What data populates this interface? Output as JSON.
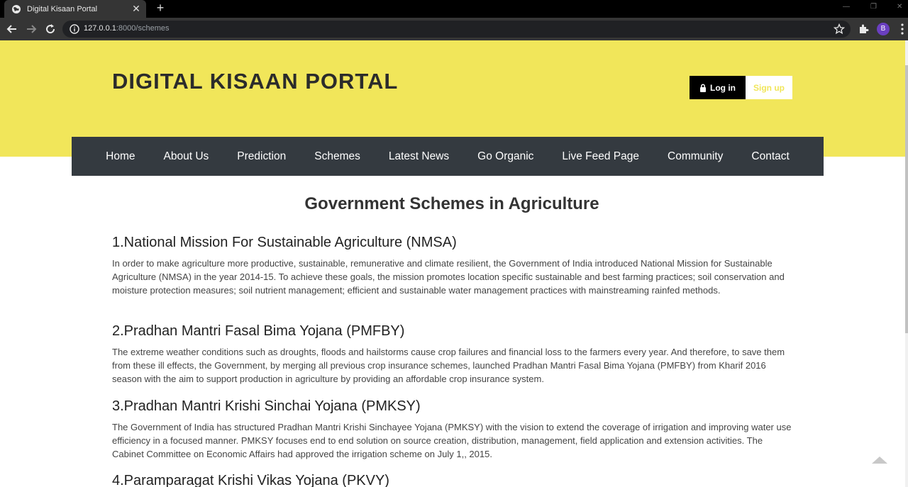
{
  "browser": {
    "tab_title": "Digital Kisaan Portal",
    "url_host": "127.0.0.1",
    "url_rest": ":8000/schemes",
    "profile_initial": "B"
  },
  "header": {
    "site_title": "DIGITAL KISAAN PORTAL",
    "login_label": "Log in",
    "signup_label": "Sign up"
  },
  "nav": {
    "items": [
      "Home",
      "About Us",
      "Prediction",
      "Schemes",
      "Latest News",
      "Go Organic",
      "Live Feed Page",
      "Community",
      "Contact"
    ]
  },
  "main": {
    "heading": "Government Schemes in Agriculture",
    "schemes": [
      {
        "title": "1.National Mission For Sustainable Agriculture (NMSA)",
        "text": "In order to make agriculture more productive, sustainable, remunerative and climate resilient, the Government of India introduced National Mission for Sustainable Agriculture (NMSA) in the year 2014-15. To achieve these goals, the mission promotes location specific sustainable and best farming practices; soil conservation and moisture protection measures; soil nutrient management; efficient and sustainable water management practices with mainstreaming rainfed methods."
      },
      {
        "title": "2.Pradhan Mantri Fasal Bima Yojana (PMFBY)",
        "text": "The extreme weather conditions such as droughts, floods and hailstorms cause crop failures and financial loss to the farmers every year. And therefore, to save them from these ill effects, the Government, by merging all previous crop insurance schemes, launched Pradhan Mantri Fasal Bima Yojana (PMFBY) from Kharif 2016 season with the aim to support production in agriculture by providing an affordable crop insurance system."
      },
      {
        "title": "3.Pradhan Mantri Krishi Sinchai Yojana (PMKSY)",
        "text": "The Government of India has structured Pradhan Mantri Krishi Sinchayee Yojana (PMKSY) with the vision to extend the coverage of irrigation and improving water use efficiency in a focused manner. PMKSY focuses end to end solution on source creation, distribution, management, field application and extension activities. The Cabinet Committee on Economic Affairs had approved the irrigation scheme on July 1,, 2015."
      },
      {
        "title": "4.Paramparagat Krishi Vikas Yojana (PKVY)",
        "text": ""
      }
    ]
  },
  "colors": {
    "hero": "#f1e65a",
    "nav": "#343a40"
  }
}
